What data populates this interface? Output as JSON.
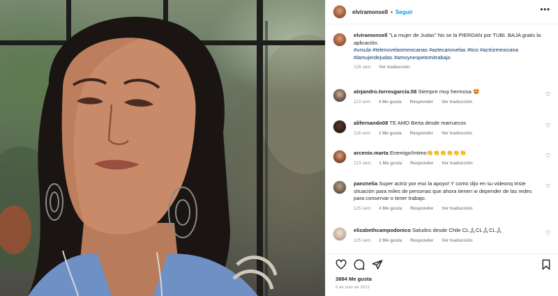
{
  "post": {
    "username": "elviramonsell",
    "follow_label": "Seguir",
    "caption": {
      "username": "elviramonsell",
      "text": "\"La mujer de Judas\" No se la PIERDAN por TUBI. BAJA gratis la aplicación.",
      "hashtags": "#ursula #telenovelasmexicanas #aztecanovelas #tico #actrizmexicana #lamujerdejudas #amoynespetomitrabajo",
      "time": "126 sem",
      "translate_label": "Ver traducción"
    },
    "comments": [
      {
        "username": "alejandro.torresgarcia.58",
        "text": "Siempre muy hermosa 🤩",
        "time": "113 sem",
        "likes": "4 Me gusta",
        "reply_label": "Responder",
        "translate_label": "Ver traducción"
      },
      {
        "username": "alifernando08",
        "text": "TE AMO Berta desde marruecos",
        "time": "118 sem",
        "likes": "1 Me gusta",
        "reply_label": "Responder",
        "translate_label": "Ver traducción"
      },
      {
        "username": "arcenio.marta",
        "text": "Enemigo/Intimo👏👏👏👏👏👏",
        "time": "123 sem",
        "likes": "1 Me gusta",
        "reply_label": "Responder",
        "translate_label": "Ver traducción"
      },
      {
        "username": "paeznelia",
        "text": "Super actriz por eso la apoyo! Y como dijo en su videonq triste situación para miles de personas que ahora tienen w depender de las redes para conservar o tener trabajo.",
        "time": "125 sem",
        "likes": "4 Me gusta",
        "reply_label": "Responder",
        "translate_label": "Ver traducción"
      },
      {
        "username": "elizabethcampodonico",
        "text": "Saludos desde Chile CL🙏🏼CL🙏🏼CL🙏🏼",
        "time": "125 sem",
        "likes": "2 Me gusta",
        "reply_label": "Responder",
        "translate_label": "Ver traducción"
      }
    ],
    "like_count": "3884 Me gusta",
    "date": "5 de julio de 2021",
    "icons": {
      "like": "heart-outline-icon",
      "comment": "comment-bubble-icon",
      "share": "send-paper-plane-icon",
      "save": "bookmark-icon",
      "more": "ellipsis-icon"
    },
    "colors": {
      "follow": "#0095f6",
      "hashtag": "#00376b",
      "muted": "#8e8e8e",
      "text": "#262626"
    }
  }
}
